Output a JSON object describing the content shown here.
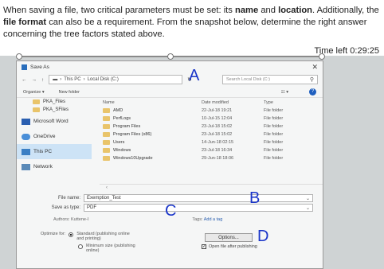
{
  "question": {
    "p1": "When saving a file, two critical parameters must be set: its ",
    "b1": "name",
    "p2": " and ",
    "b2": "location",
    "p3": ". Additionally, the ",
    "b3": "file format",
    "p4": " can also be a requirement. From the snapshot below, determine the right answer concerning the tree factors stated above."
  },
  "timer": {
    "label": "Time left",
    "value": "0:29:25"
  },
  "dialog": {
    "title": "Save As",
    "close_glyph": "✕",
    "breadcrumb": [
      "This PC",
      "Local Disk (C:)"
    ],
    "search_placeholder": "Search Local Disk (C:)",
    "organize_label": "Organize ▾",
    "new_folder_label": "New folder",
    "help_glyph": "?"
  },
  "nav": {
    "items": [
      {
        "label": "PKA_Files",
        "kind": "folder"
      },
      {
        "label": "PKA_SFiles",
        "kind": "folder"
      },
      {
        "label": "Microsoft Word",
        "kind": "big"
      },
      {
        "label": "OneDrive",
        "kind": "big"
      },
      {
        "label": "This PC",
        "kind": "big"
      },
      {
        "label": "Network",
        "kind": "big"
      }
    ]
  },
  "files": {
    "headers": {
      "name": "Name",
      "date": "Date modified",
      "type": "Type"
    },
    "rows": [
      {
        "name": "AMD",
        "date": "22-Jul-18 19:21",
        "type": "File folder"
      },
      {
        "name": "PerfLogs",
        "date": "10-Jul-15 12:04",
        "type": "File folder"
      },
      {
        "name": "Program Files",
        "date": "23-Jul-18 15:02",
        "type": "File folder"
      },
      {
        "name": "Program Files (x86)",
        "date": "23-Jul-18 15:02",
        "type": "File folder"
      },
      {
        "name": "Users",
        "date": "14-Jun-18 02:15",
        "type": "File folder"
      },
      {
        "name": "Windows",
        "date": "23-Jul-18 16:34",
        "type": "File folder"
      },
      {
        "name": "Windows10Upgrade",
        "date": "29-Jun-18 18:06",
        "type": "File folder"
      }
    ]
  },
  "form": {
    "filename_label": "File name:",
    "filename_value": "Exemption_Test",
    "savetype_label": "Save as type:",
    "savetype_value": "PDF",
    "authors_label": "Authors:",
    "authors_value": "Kuttene-I",
    "tags_label": "Tags:",
    "tags_value": "Add a tag",
    "optimize_label": "Optimize for:",
    "opt_standard": "Standard (publishing online and printing)",
    "opt_minimum": "Minimum size (publishing online)",
    "options_button": "Options...",
    "open_after_label": "Open file after publishing"
  },
  "annotations": [
    "A",
    "B",
    "C",
    "D"
  ],
  "colors": {
    "annotation_ink": "#1a35c9",
    "accent": "#2a6ebc"
  }
}
